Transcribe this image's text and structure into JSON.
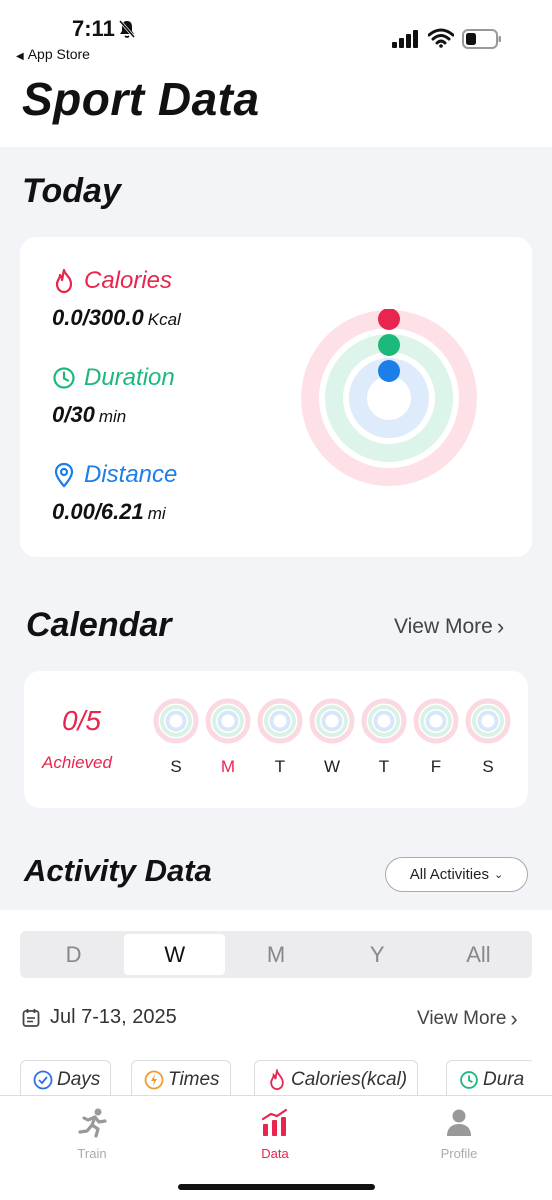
{
  "status_bar": {
    "time": "7:11",
    "back_label": "App Store",
    "icons": [
      "bell-slash-icon",
      "signal-icon",
      "wifi-icon",
      "battery-icon"
    ]
  },
  "header": {
    "title": "Sport Data"
  },
  "today": {
    "title": "Today",
    "metrics": [
      {
        "label": "Calories",
        "value": "0.0/300.0",
        "unit": "Kcal",
        "color": "#e8254f",
        "icon": "flame-icon"
      },
      {
        "label": "Duration",
        "value": "0/30",
        "unit": "min",
        "color": "#1db97a",
        "icon": "clock-icon"
      },
      {
        "label": "Distance",
        "value": "0.00/6.21",
        "unit": "mi",
        "color": "#1e7ee8",
        "icon": "location-pin-icon"
      }
    ]
  },
  "calendar": {
    "title": "Calendar",
    "view_more": "View More",
    "achieved_count": "0/5",
    "achieved_label": "Achieved",
    "days": [
      {
        "label": "S",
        "active": false
      },
      {
        "label": "M",
        "active": true
      },
      {
        "label": "T",
        "active": false
      },
      {
        "label": "W",
        "active": false
      },
      {
        "label": "T",
        "active": false
      },
      {
        "label": "F",
        "active": false
      },
      {
        "label": "S",
        "active": false
      }
    ]
  },
  "activity": {
    "title": "Activity Data",
    "filter_selected": "All Activities",
    "segments": [
      "D",
      "W",
      "M",
      "Y",
      "All"
    ],
    "active_segment": "W",
    "date_range": "Jul 7-13, 2025",
    "view_more": "View More",
    "chips": [
      {
        "label": "Days",
        "icon": "check-circle-icon",
        "color": "#2f6fe0"
      },
      {
        "label": "Times",
        "icon": "lightning-circle-icon",
        "color": "#f39a2c"
      },
      {
        "label": "Calories(kcal)",
        "icon": "flame-icon",
        "color": "#e8254f"
      },
      {
        "label": "Dura",
        "icon": "clock-icon",
        "color": "#1db97a"
      }
    ]
  },
  "tab_bar": {
    "items": [
      {
        "label": "Train",
        "icon": "runner-icon",
        "active": false
      },
      {
        "label": "Data",
        "icon": "bar-chart-icon",
        "active": true
      },
      {
        "label": "Profile",
        "icon": "person-icon",
        "active": false
      }
    ]
  },
  "colors": {
    "calories": "#e8254f",
    "duration": "#1db97a",
    "distance": "#1e7ee8",
    "background": "#f3f4f8"
  }
}
